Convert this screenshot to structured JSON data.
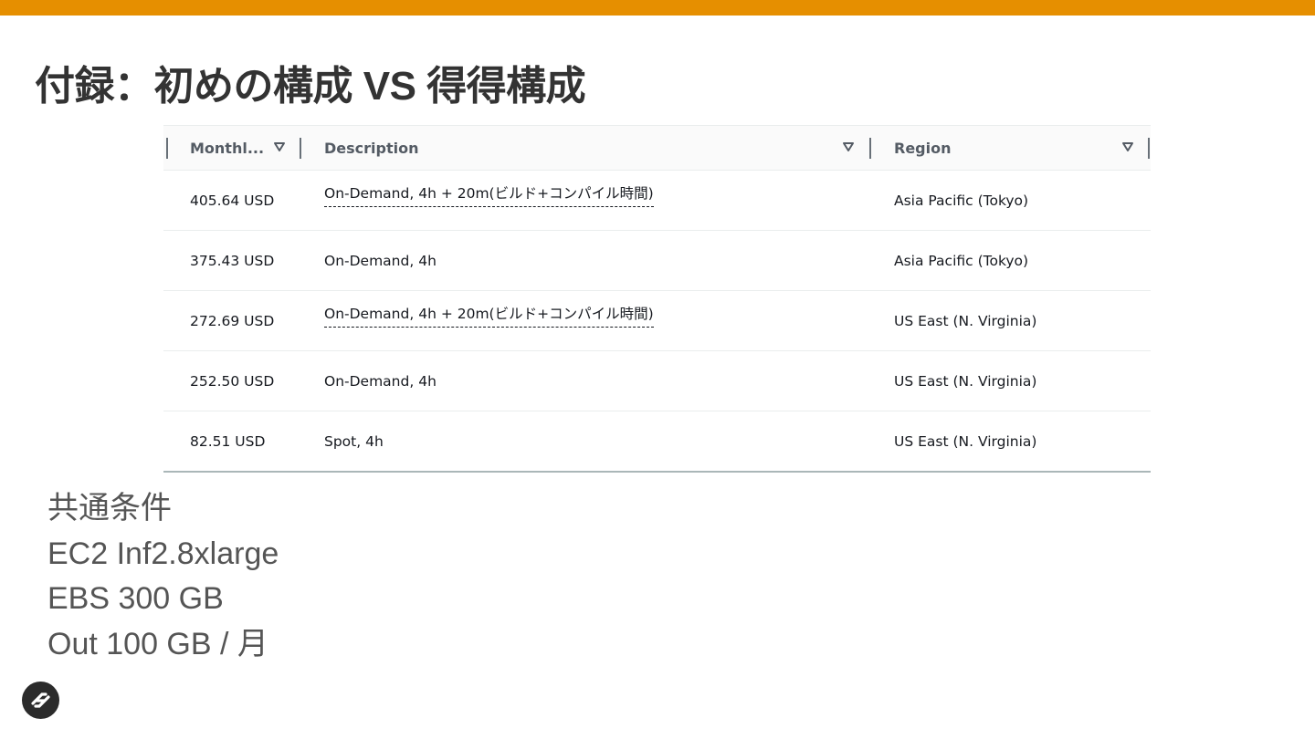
{
  "slide": {
    "title": "付録：初めの構成 VS 得得構成"
  },
  "table": {
    "columns": [
      {
        "label": "Monthl..."
      },
      {
        "label": "Description"
      },
      {
        "label": "Region"
      }
    ],
    "rows": [
      {
        "monthly": "405.64 USD",
        "description": "On-Demand, 4h + 20m(ビルド+コンパイル時間)",
        "region": "Asia Pacific (Tokyo)"
      },
      {
        "monthly": "375.43 USD",
        "description": "On-Demand, 4h",
        "region": "Asia Pacific (Tokyo)"
      },
      {
        "monthly": "272.69 USD",
        "description": "On-Demand, 4h + 20m(ビルド+コンパイル時間)",
        "region": "US East (N. Virginia)"
      },
      {
        "monthly": "252.50 USD",
        "description": "On-Demand, 4h",
        "region": "US East (N. Virginia)"
      },
      {
        "monthly": "82.51 USD",
        "description": "Spot, 4h",
        "region": "US East (N. Virginia)"
      }
    ],
    "sort_icon": "triangle-down-icon"
  },
  "conditions": {
    "lines": [
      "共通条件",
      "EC2 Inf2.8xlarge",
      "EBS 300 GB",
      "Out 100 GB / 月"
    ]
  },
  "colors": {
    "accent_bar": "#e68f00",
    "title_text": "#333333",
    "header_text": "#545b64"
  },
  "logo_icon": "brand-logo-icon"
}
